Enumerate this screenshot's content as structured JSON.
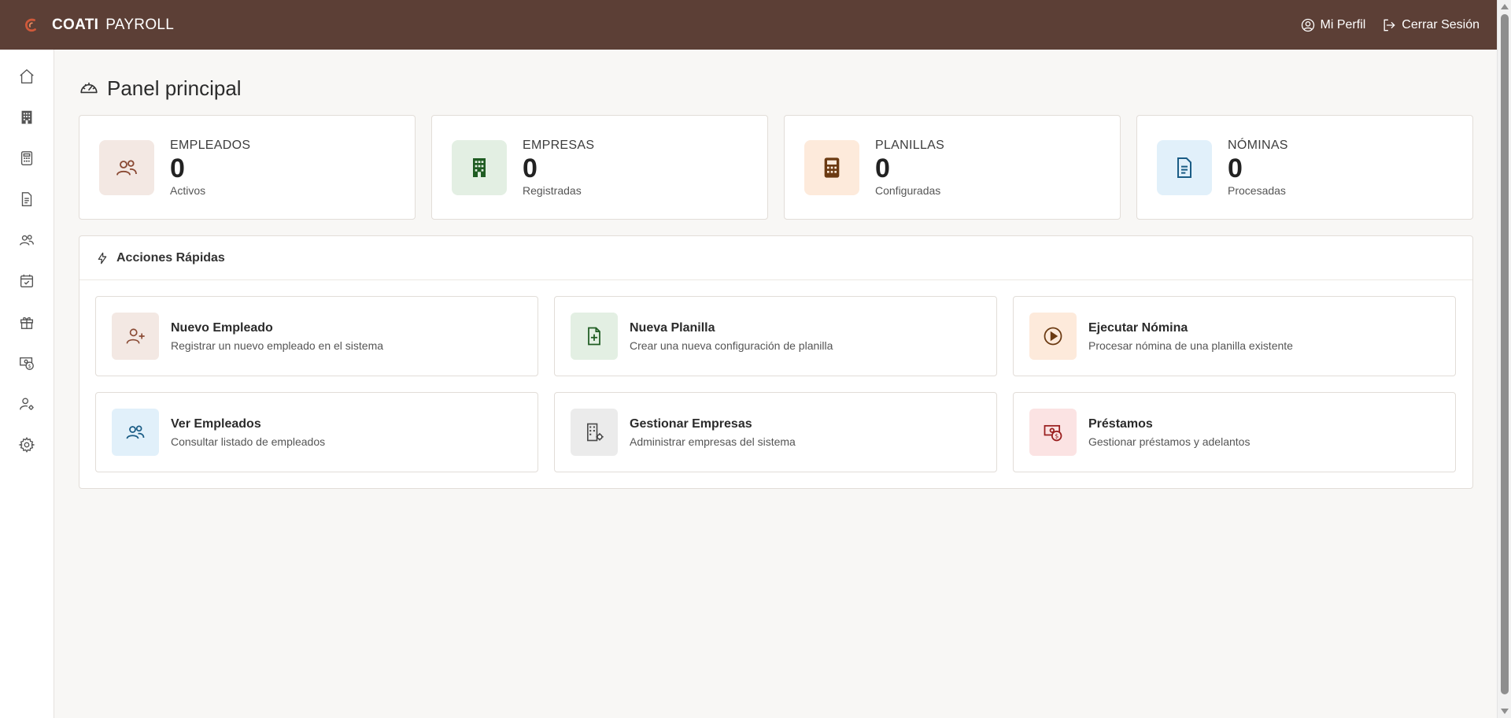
{
  "brand": {
    "name": "COATI",
    "suffix": "PAYROLL"
  },
  "top_nav": {
    "profile": "Mi Perfil",
    "logout": "Cerrar Sesión"
  },
  "sidebar": {
    "items": [
      {
        "icon": "home-icon"
      },
      {
        "icon": "building-icon"
      },
      {
        "icon": "calculator-icon"
      },
      {
        "icon": "document-icon"
      },
      {
        "icon": "people-icon"
      },
      {
        "icon": "calendar-check-icon"
      },
      {
        "icon": "gift-icon"
      },
      {
        "icon": "cash-coin-icon"
      },
      {
        "icon": "person-gear-icon"
      },
      {
        "icon": "gear-icon"
      }
    ]
  },
  "page": {
    "title": "Panel principal"
  },
  "stats": [
    {
      "label": "EMPLEADOS",
      "value": "0",
      "sub": "Activos",
      "icon": "people-icon",
      "bg": "#f3e8e3",
      "fg": "#8a4a34"
    },
    {
      "label": "EMPRESAS",
      "value": "0",
      "sub": "Registradas",
      "icon": "building-icon",
      "bg": "#e3efe3",
      "fg": "#1f5c22"
    },
    {
      "label": "PLANILLAS",
      "value": "0",
      "sub": "Configuradas",
      "icon": "calculator-icon",
      "bg": "#fdeadb",
      "fg": "#6b3a12"
    },
    {
      "label": "NÓMINAS",
      "value": "0",
      "sub": "Procesadas",
      "icon": "document-icon",
      "bg": "#e1f0fa",
      "fg": "#1a5c85"
    }
  ],
  "quick_actions": {
    "title": "Acciones Rápidas",
    "items": [
      {
        "title": "Nuevo Empleado",
        "desc": "Registrar un nuevo empleado en el sistema",
        "icon": "person-add-icon",
        "bg": "#f3e8e3",
        "fg": "#8a4a34"
      },
      {
        "title": "Nueva Planilla",
        "desc": "Crear una nueva configuración de planilla",
        "icon": "file-plus-icon",
        "bg": "#e3efe3",
        "fg": "#1f5c22"
      },
      {
        "title": "Ejecutar Nómina",
        "desc": "Procesar nómina de una planilla existente",
        "icon": "play-circle-icon",
        "bg": "#fdeadb",
        "fg": "#6b3a12"
      },
      {
        "title": "Ver Empleados",
        "desc": "Consultar listado de empleados",
        "icon": "people-icon",
        "bg": "#e1f0fa",
        "fg": "#1a5c85"
      },
      {
        "title": "Gestionar Empresas",
        "desc": "Administrar empresas del sistema",
        "icon": "building-gear-icon",
        "bg": "#ebebeb",
        "fg": "#4a4a4a"
      },
      {
        "title": "Préstamos",
        "desc": "Gestionar préstamos y adelantos",
        "icon": "cash-coin-icon",
        "bg": "#fbe3e3",
        "fg": "#9a1f1f"
      }
    ]
  },
  "colors": {
    "topbar": "#5c3f36",
    "accent": "#c0502e",
    "background": "#f8f7f5"
  }
}
